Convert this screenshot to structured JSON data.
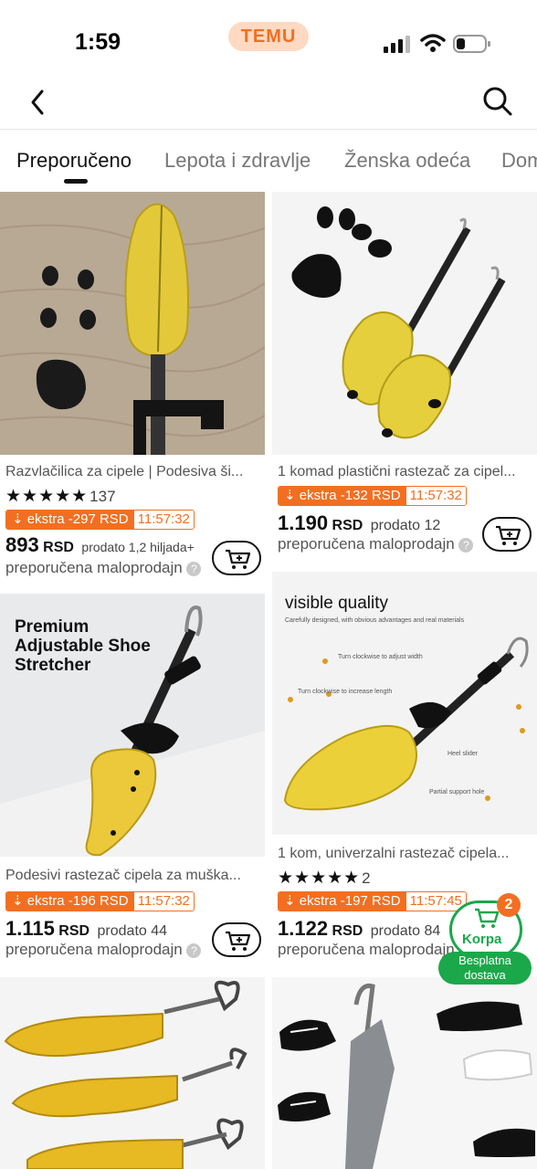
{
  "status_bar": {
    "time": "1:59",
    "app_logo": "TEMU"
  },
  "nav": {
    "back_icon": "chevron-left-icon",
    "search_icon": "search-icon"
  },
  "tabs": [
    {
      "label": "Preporučeno",
      "active": true
    },
    {
      "label": "Lepota i zdravlje",
      "active": false
    },
    {
      "label": "Ženska odeća",
      "active": false
    },
    {
      "label": "Dom",
      "active": false
    }
  ],
  "products": [
    {
      "title": "Razvlačilica za cipele | Podesiva ši...",
      "rating_count": "137",
      "promo_label": "ekstra -297 RSD",
      "promo_timer": "11:57:32",
      "price": "893",
      "currency": "RSD",
      "sold": "prodato 1,2 hiljada+",
      "retail": "preporučena maloprodajn"
    },
    {
      "title": "1 komad plastični rastezač za cipel...",
      "promo_label": "ekstra -132 RSD",
      "promo_timer": "11:57:32",
      "price": "1.190",
      "currency": "RSD",
      "sold": "prodato 12",
      "retail": "preporučena maloprodajn"
    },
    {
      "title": "Podesivi rastezač cipela za muška...",
      "image_caption": "Premium Adjustable Shoe Stretcher",
      "promo_label": "ekstra -196 RSD",
      "promo_timer": "11:57:32",
      "price": "1.115",
      "currency": "RSD",
      "sold": "prodato 44",
      "retail": "preporučena maloprodajn"
    },
    {
      "title": "1 kom, univerzalni rastezač cipela...",
      "image_caption": "visible quality",
      "image_subcaption": "Carefully designed, with obvious advantages and real materials",
      "image_annotations": [
        "Turn clockwise to adjust width",
        "Turn clockwise to increase length",
        "Heel slider",
        "Partial support hole"
      ],
      "rating_count": "2",
      "promo_label": "ekstra -197 RSD",
      "promo_timer": "11:57:45",
      "price": "1.122",
      "currency": "RSD",
      "sold": "prodato 84",
      "retail": "preporučena maloprodajn"
    }
  ],
  "floating_cart": {
    "label": "Korpa",
    "badge": "2",
    "shipping": "Besplatna dostava"
  },
  "colors": {
    "accent": "#f26f21",
    "green": "#1aa84a"
  }
}
